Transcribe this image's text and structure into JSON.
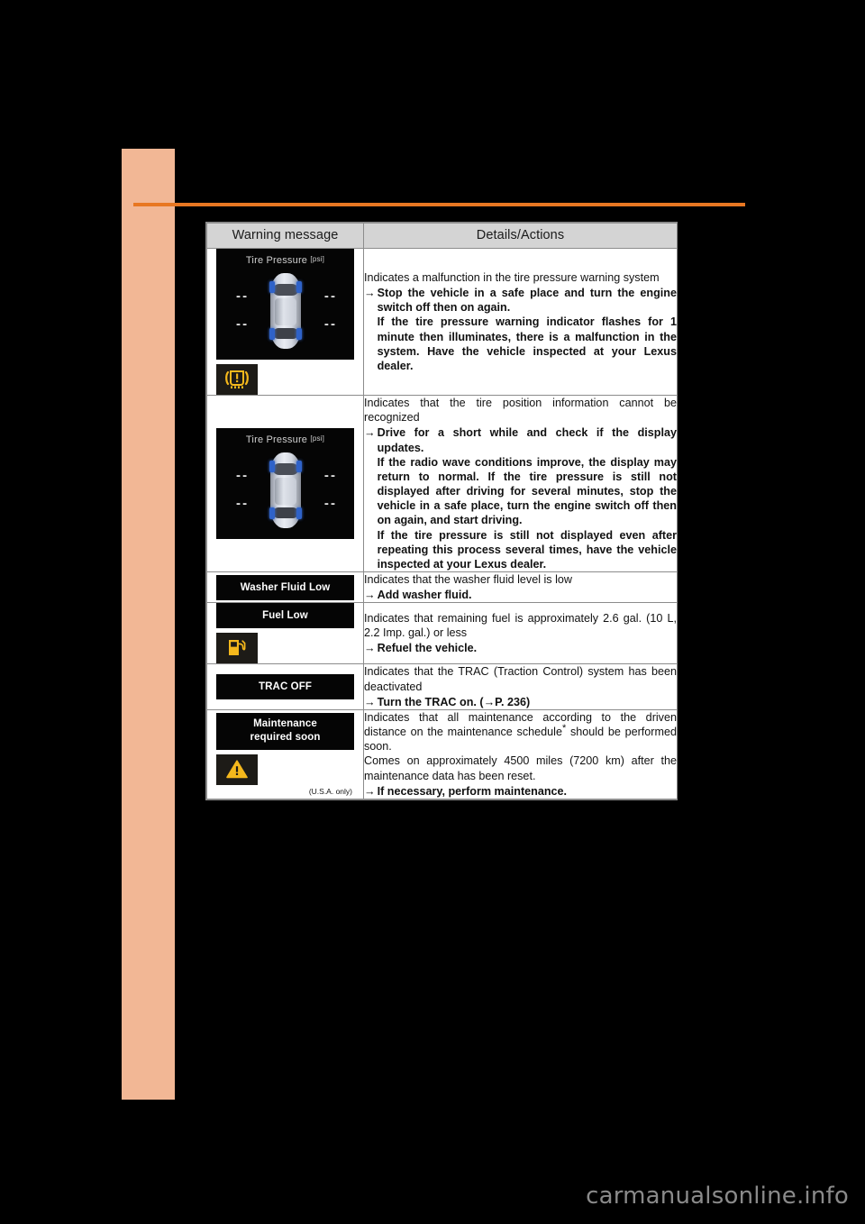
{
  "page": {
    "background_color": "#000000",
    "side_tab_color": "#f2b795",
    "rule_color": "#e87722",
    "watermark": "carmanualsonline.info"
  },
  "table": {
    "headers": {
      "col1": "Warning message",
      "col2": "Details/Actions"
    },
    "rows": [
      {
        "id": "tpms-malfunction",
        "message_type": "display-tire-pressure",
        "display": {
          "title": "Tire Pressure",
          "unit": "[psi]",
          "tire_values": [
            "- -",
            "- -",
            "- -",
            "- -"
          ]
        },
        "indicator_icon": "tire-pressure-warning-icon",
        "details_intro": "Indicates a malfunction in the tire pressure warning system",
        "actions": [
          {
            "bold": "Stop the vehicle in a safe place and turn the engine switch off then on again.",
            "follow_up": "If the tire pressure warning indicator flashes for 1 minute then illuminates, there is a malfunction in the system. Have the vehicle inspected at your Lexus dealer."
          }
        ]
      },
      {
        "id": "tire-position-unrecognized",
        "message_type": "display-tire-pressure",
        "display": {
          "title": "Tire Pressure",
          "unit": "[psi]",
          "tire_values": [
            "- -",
            "- -",
            "- -",
            "- -"
          ]
        },
        "indicator_icon": null,
        "details_intro": "Indicates that the tire position information cannot be recognized",
        "actions": [
          {
            "bold": "Drive for a short while and check if the display updates.",
            "follow_up": "If the radio wave conditions improve, the display may return to normal. If the tire pressure is still not displayed after driving for several minutes, stop the vehicle in a safe place, turn the engine switch off then on again, and start driving. If the tire pressure is still not displayed even after repeating this process several times, have the vehicle inspected at your Lexus dealer.",
            "follow_up_parts": [
              "If the radio wave conditions improve, the display may return to normal. If the tire pressure is still not displayed after driving for several minutes, stop the vehicle in a safe place, turn the engine switch off then on again, and start driving.",
              "If the tire pressure is still not displayed even after repeating this process several times, have the vehicle inspected at your Lexus dealer."
            ]
          }
        ]
      },
      {
        "id": "washer-fluid-low",
        "message_type": "banner",
        "banner_text": "Washer Fluid Low",
        "indicator_icon": null,
        "details_intro": "Indicates that the washer fluid level is low",
        "actions": [
          {
            "bold": "Add washer fluid.",
            "follow_up": ""
          }
        ]
      },
      {
        "id": "fuel-low",
        "message_type": "banner",
        "banner_text": "Fuel Low",
        "indicator_icon": "fuel-pump-icon",
        "details_intro": "Indicates that remaining fuel is approximately 2.6 gal. (10 L, 2.2 Imp. gal.) or less",
        "actions": [
          {
            "bold": "Refuel the vehicle.",
            "follow_up": ""
          }
        ]
      },
      {
        "id": "trac-off",
        "message_type": "banner",
        "banner_text": "TRAC OFF",
        "indicator_icon": null,
        "details_intro": "Indicates that the TRAC (Traction Control) system has been deactivated",
        "actions": [
          {
            "bold": "Turn the TRAC on. (→P. 236)",
            "follow_up": ""
          }
        ]
      },
      {
        "id": "maintenance-required-soon",
        "message_type": "banner",
        "banner_text_line1": "Maintenance",
        "banner_text_line2": "required soon",
        "indicator_icon": "warning-triangle-icon",
        "note": "(U.S.A. only)",
        "details_intro": "Indicates that all maintenance according to the driven distance on the maintenance schedule* should be performed soon.",
        "details_extra": "Comes on approximately 4500 miles (7200 km) after the maintenance data has been reset.",
        "actions": [
          {
            "bold": "If necessary, perform maintenance.",
            "follow_up": ""
          }
        ]
      }
    ]
  }
}
